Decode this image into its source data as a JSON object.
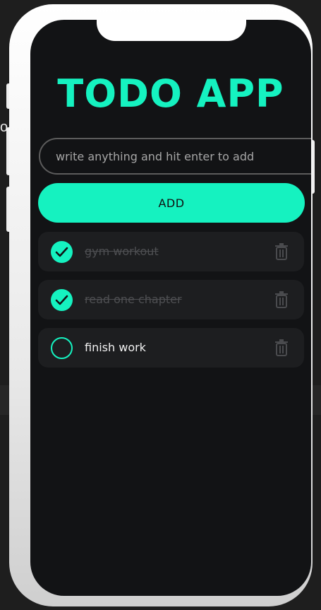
{
  "app": {
    "title": "TODO APP"
  },
  "input": {
    "placeholder": "write anything and hit enter to add",
    "value": ""
  },
  "add_button": {
    "label": "ADD"
  },
  "todos": [
    {
      "text": "gym workout",
      "completed": true
    },
    {
      "text": "read one chapter",
      "completed": true
    },
    {
      "text": "finish work",
      "completed": false
    }
  ],
  "background": {
    "edge_text": "o"
  },
  "colors": {
    "accent": "#15f2c0",
    "screen": "#121315",
    "card": "#1d1e20",
    "completed_text": "#4e4f52",
    "active_text": "#f2f2f2"
  },
  "icons": {
    "checked": "check-circle-icon",
    "unchecked": "empty-circle-icon",
    "delete": "trash-icon"
  }
}
